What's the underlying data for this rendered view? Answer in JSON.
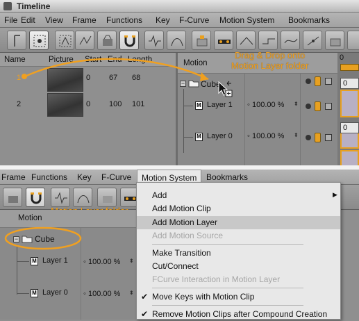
{
  "window": {
    "title": "Timeline"
  },
  "menubar_top": [
    "File",
    "Edit",
    "View",
    "Frame",
    "Functions",
    "Key",
    "F-Curve",
    "Motion System",
    "Bookmarks"
  ],
  "clips_table": {
    "headers": [
      "Name",
      "Picture",
      "Start",
      "End",
      "Length"
    ],
    "rows": [
      {
        "name": "1",
        "start": "0",
        "end": "67",
        "length": "68"
      },
      {
        "name": "2",
        "start": "0",
        "end": "100",
        "length": "101"
      }
    ]
  },
  "motion_header": "Motion",
  "timeline_frame": "0",
  "tree_top": {
    "folder": "Cube",
    "layers": [
      {
        "name": "Layer 1",
        "value": "100.00 %"
      },
      {
        "name": "Layer 0",
        "value": "100.00 %"
      }
    ]
  },
  "right_track_values": [
    "0",
    "0",
    "0"
  ],
  "annotations": {
    "drag": [
      "Drag & Drop onto",
      "Motion Layer folder"
    ],
    "selected": [
      "Motion Layer folder",
      "selected"
    ]
  },
  "menubar_bottom": {
    "items": [
      "Frame",
      "Functions",
      "Key",
      "F-Curve",
      "Motion System",
      "Bookmarks"
    ],
    "active": "Motion System"
  },
  "tree_bottom": {
    "header": "Motion",
    "folder": "Cube",
    "layers": [
      {
        "name": "Layer 1",
        "value": "100.00 %"
      },
      {
        "name": "Layer 0",
        "value": "100.00 %"
      }
    ]
  },
  "motion_menu": {
    "items": [
      {
        "label": "Add",
        "submenu": true,
        "state": "normal"
      },
      {
        "label": "Add Motion Clip",
        "state": "normal"
      },
      {
        "label": "Add Motion Layer",
        "state": "highlighted"
      },
      {
        "label": "Add Motion Source",
        "state": "disabled"
      },
      {
        "label": "Make Transition",
        "state": "normal"
      },
      {
        "label": "Cut/Connect",
        "state": "normal"
      },
      {
        "label": "FCurve Interaction in Motion Layer",
        "state": "disabled"
      },
      {
        "label": "Move Keys with Motion Clip",
        "state": "checked"
      },
      {
        "label": "Remove Motion Clips after Compound Creation",
        "state": "checked"
      }
    ]
  },
  "colors": {
    "accent_orange": "#f0a020",
    "background": "#8f8f8f",
    "menu_bg": "#e8e8e8",
    "menu_highlight": "#c8c8c8"
  }
}
